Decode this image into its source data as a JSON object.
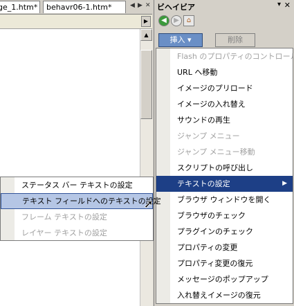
{
  "doc_tabs": [
    "ge_1.htm*",
    "behavr06-1.htm*"
  ],
  "panel": {
    "title": "ビヘイビア",
    "insert_label": "挿入 ▾",
    "delete_label": "削除"
  },
  "main_menu": [
    {
      "label": "Flash のプロパティのコントロール",
      "enabled": false
    },
    {
      "label": "URL へ移動",
      "enabled": true
    },
    {
      "label": "イメージのプリロード",
      "enabled": true
    },
    {
      "label": "イメージの入れ替え",
      "enabled": true
    },
    {
      "label": "サウンドの再生",
      "enabled": true
    },
    {
      "label": "ジャンプ メニュー",
      "enabled": false
    },
    {
      "label": "ジャンプ メニュー移動",
      "enabled": false
    },
    {
      "label": "スクリプトの呼び出し",
      "enabled": true
    },
    {
      "label": "テキストの設定",
      "enabled": true,
      "highlighted": true,
      "submenu": true
    },
    {
      "label": "ブラウザ ウィンドウを開く",
      "enabled": true
    },
    {
      "label": "ブラウザのチェック",
      "enabled": true
    },
    {
      "label": "プラグインのチェック",
      "enabled": true
    },
    {
      "label": "プロパティの変更",
      "enabled": true
    },
    {
      "label": "プロパティ変更の復元",
      "enabled": true
    },
    {
      "label": "メッセージのポップアップ",
      "enabled": true
    },
    {
      "label": "入れ替えイメージの復元",
      "enabled": true
    }
  ],
  "sub_menu": [
    {
      "label": "ステータス バー テキストの設定",
      "enabled": true
    },
    {
      "label": "テキスト フィールドへのテキストの設定",
      "enabled": true,
      "hover": true
    },
    {
      "label": "フレーム テキストの設定",
      "enabled": false
    },
    {
      "label": "レイヤー テキストの設定",
      "enabled": false
    }
  ]
}
